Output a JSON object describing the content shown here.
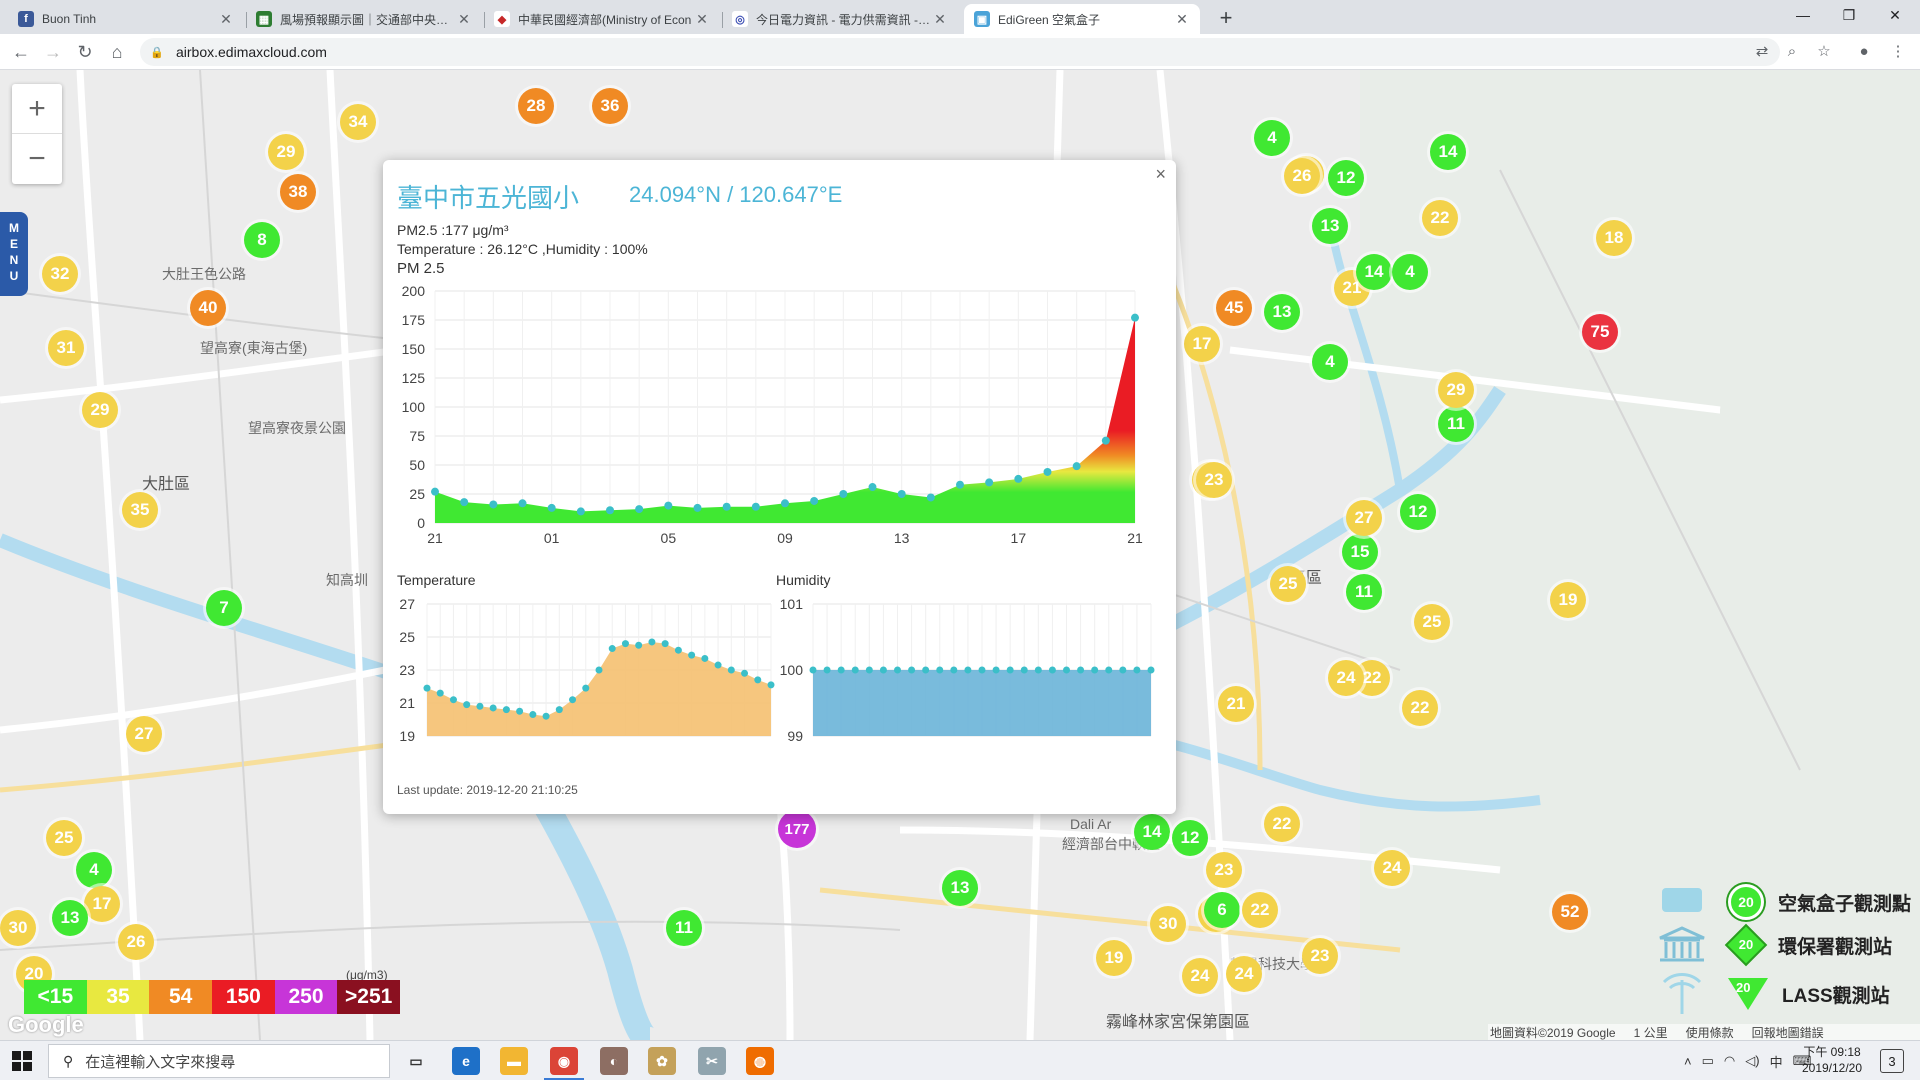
{
  "browser": {
    "tabs": [
      {
        "label": "Buon Tinh",
        "fav_color": "#3b5998",
        "fav_glyph": "f",
        "active": false
      },
      {
        "label": "風場預報顯示圖｜交通部中央氣象",
        "fav_color": "#2e7d32",
        "fav_glyph": "▦",
        "active": false
      },
      {
        "label": "中華民國經濟部(Ministry of Econ",
        "fav_color": "#ffffff",
        "fav_glyph": "◆",
        "active": false
      },
      {
        "label": "今日電力資訊 - 電力供需資訊 - 臺",
        "fav_color": "#ffffff",
        "fav_glyph": "◎",
        "active": false
      },
      {
        "label": "EdiGreen 空氣盒子",
        "fav_color": "#4aa3d8",
        "fav_glyph": "▣",
        "active": true
      }
    ],
    "url": "airbox.edimaxcloud.com"
  },
  "map": {
    "labels": [
      {
        "text": "大肚區",
        "big": true
      },
      {
        "text": "望高寮(東海古堡)",
        "big": false
      },
      {
        "text": "望高寮夜景公園",
        "big": false
      },
      {
        "text": "知高圳",
        "big": false
      },
      {
        "text": "大肚區",
        "big": false
      },
      {
        "text": "平區",
        "big": true
      },
      {
        "text": "Dali Ar",
        "big": false
      },
      {
        "text": "經濟部台中軟體",
        "big": false
      },
      {
        "text": "霧峰林家宮保第園區",
        "big": true
      },
      {
        "text": "朝陽科技大學",
        "big": false
      },
      {
        "text": "大肚王色公路",
        "big": false
      }
    ],
    "markers": [
      {
        "v": "34",
        "c": "yellow"
      },
      {
        "v": "29",
        "c": "yellow"
      },
      {
        "v": "38",
        "c": "orange"
      },
      {
        "v": "8",
        "c": "green"
      },
      {
        "v": "40",
        "c": "orange"
      },
      {
        "v": "32",
        "c": "yellow"
      },
      {
        "v": "31",
        "c": "yellow"
      },
      {
        "v": "29",
        "c": "yellow"
      },
      {
        "v": "35",
        "c": "yellow"
      },
      {
        "v": "7",
        "c": "green"
      },
      {
        "v": "27",
        "c": "yellow"
      },
      {
        "v": "25",
        "c": "yellow"
      },
      {
        "v": "4",
        "c": "green"
      },
      {
        "v": "17",
        "c": "yellow"
      },
      {
        "v": "13",
        "c": "green"
      },
      {
        "v": "26",
        "c": "yellow"
      },
      {
        "v": "20",
        "c": "yellow"
      },
      {
        "v": "30",
        "c": "yellow"
      },
      {
        "v": "11",
        "c": "green"
      },
      {
        "v": "13",
        "c": "green"
      },
      {
        "v": "23",
        "c": "yellow"
      },
      {
        "v": "14",
        "c": "green"
      },
      {
        "v": "12",
        "c": "green"
      },
      {
        "v": "23",
        "c": "yellow"
      },
      {
        "v": "30",
        "c": "yellow"
      },
      {
        "v": "6",
        "c": "green"
      },
      {
        "v": "22",
        "c": "yellow"
      },
      {
        "v": "19",
        "c": "yellow"
      },
      {
        "v": "24",
        "c": "yellow"
      },
      {
        "v": "24",
        "c": "yellow"
      },
      {
        "v": "23",
        "c": "yellow"
      },
      {
        "v": "22",
        "c": "yellow"
      },
      {
        "v": "24",
        "c": "yellow"
      },
      {
        "v": "52",
        "c": "orange"
      },
      {
        "v": "22",
        "c": "yellow"
      },
      {
        "v": "21",
        "c": "yellow"
      },
      {
        "v": "22",
        "c": "yellow"
      },
      {
        "v": "24",
        "c": "yellow"
      },
      {
        "v": "25",
        "c": "yellow"
      },
      {
        "v": "19",
        "c": "yellow"
      },
      {
        "v": "25",
        "c": "yellow"
      },
      {
        "v": "11",
        "c": "green"
      },
      {
        "v": "15",
        "c": "green"
      },
      {
        "v": "27",
        "c": "yellow"
      },
      {
        "v": "12",
        "c": "green"
      },
      {
        "v": "25",
        "c": "yellow"
      },
      {
        "v": "23",
        "c": "yellow"
      },
      {
        "v": "11",
        "c": "green"
      },
      {
        "v": "29",
        "c": "yellow"
      },
      {
        "v": "4",
        "c": "green"
      },
      {
        "v": "13",
        "c": "green"
      },
      {
        "v": "45",
        "c": "orange"
      },
      {
        "v": "17",
        "c": "yellow"
      },
      {
        "v": "21",
        "c": "yellow"
      },
      {
        "v": "14",
        "c": "green"
      },
      {
        "v": "4",
        "c": "green"
      },
      {
        "v": "13",
        "c": "green"
      },
      {
        "v": "12",
        "c": "green"
      },
      {
        "v": "26",
        "c": "yellow"
      },
      {
        "v": "4",
        "c": "green"
      },
      {
        "v": "14",
        "c": "green"
      },
      {
        "v": "22",
        "c": "yellow"
      },
      {
        "v": "18",
        "c": "yellow"
      },
      {
        "v": "75",
        "c": "red"
      },
      {
        "v": "26",
        "c": "yellow"
      },
      {
        "v": "28",
        "c": "orange"
      },
      {
        "v": "36",
        "c": "orange"
      },
      {
        "v": "177",
        "c": "purple"
      }
    ],
    "diamond_value": "11",
    "legend": [
      {
        "label": "<15",
        "color": "#40e832"
      },
      {
        "label": "35",
        "color": "#e8e840"
      },
      {
        "label": "54",
        "color": "#f08a24"
      },
      {
        "label": "150",
        "color": "#ea1c24"
      },
      {
        "label": "250",
        "color": "#c735d8"
      },
      {
        "label": ">251",
        "color": "#8a1020"
      }
    ],
    "legend_unit": "(μg/m3)",
    "google": "Google",
    "key": [
      {
        "value": "20",
        "label": "空氣盒子觀測點",
        "shape": "circle"
      },
      {
        "value": "20",
        "label": "環保署觀測站",
        "shape": "diamond"
      },
      {
        "value": "20",
        "label": "LASS觀測站",
        "shape": "triangle"
      }
    ],
    "footer": [
      "地圖資料©2019 Google",
      "1 公里",
      "使用條款",
      "回報地圖錯誤"
    ],
    "menu_label": [
      "M",
      "E",
      "N",
      "U"
    ]
  },
  "popup": {
    "title": "臺中市五光國小",
    "coords": "24.094°N / 120.647°E",
    "pm25_line": "PM2.5 :177 μg/m³",
    "temp_line": "Temperature : 26.12°C ,Humidity : 100%",
    "chart_label": "PM 2.5",
    "temp_label": "Temperature",
    "hum_label": "Humidity",
    "updated": "Last update: 2019-12-20 21:10:25"
  },
  "chart_data": [
    {
      "type": "area",
      "title": "PM 2.5",
      "x_ticks": [
        "21",
        "01",
        "05",
        "09",
        "13",
        "17",
        "21"
      ],
      "y_ticks": [
        0,
        25,
        50,
        75,
        100,
        125,
        150,
        175,
        200
      ],
      "ylim": [
        0,
        200
      ],
      "values": [
        27,
        18,
        16,
        17,
        13,
        10,
        11,
        12,
        15,
        13,
        14,
        14,
        17,
        19,
        25,
        31,
        25,
        22,
        33,
        35,
        38,
        44,
        49,
        71,
        177
      ],
      "colors_by_band": [
        "#40e832",
        "#e8e840",
        "#f08a24",
        "#ea1c24"
      ]
    },
    {
      "type": "area",
      "title": "Temperature",
      "y_ticks": [
        19,
        21,
        23,
        25,
        27
      ],
      "ylim": [
        19,
        27
      ],
      "values": [
        21.9,
        21.6,
        21.2,
        20.9,
        20.8,
        20.7,
        20.6,
        20.5,
        20.3,
        20.2,
        20.6,
        21.2,
        21.9,
        23.0,
        24.3,
        24.6,
        24.5,
        24.7,
        24.6,
        24.2,
        23.9,
        23.7,
        23.3,
        23.0,
        22.8,
        22.4,
        22.1
      ],
      "color": "#f5c070"
    },
    {
      "type": "area",
      "title": "Humidity",
      "y_ticks": [
        99,
        100,
        101
      ],
      "ylim": [
        99,
        101
      ],
      "values": [
        100,
        100,
        100,
        100,
        100,
        100,
        100,
        100,
        100,
        100,
        100,
        100,
        100,
        100,
        100,
        100,
        100,
        100,
        100,
        100,
        100,
        100,
        100,
        100,
        100
      ],
      "color": "#6ab4d8"
    }
  ],
  "taskbar": {
    "search_placeholder": "在這裡輸入文字來搜尋",
    "clock_line1": "下午 09:18",
    "clock_line2": "2019/12/20",
    "tray_lang": "中",
    "notif_count": "3"
  }
}
